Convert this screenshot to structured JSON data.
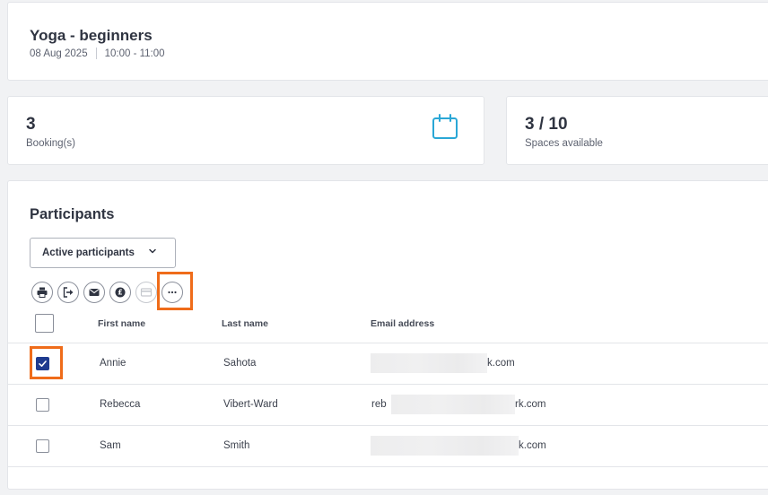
{
  "session": {
    "title": "Yoga - beginners",
    "date": "08 Aug 2025",
    "time": "10:00 - 11:00"
  },
  "stats": {
    "bookings": {
      "value": "3",
      "label": "Booking(s)",
      "icon": "calendar-icon"
    },
    "spaces": {
      "value": "3 / 10",
      "label": "Spaces available"
    }
  },
  "participants": {
    "title": "Participants",
    "filter": {
      "selected": "Active participants"
    },
    "toolbar": [
      {
        "name": "print",
        "icon": "printer-icon",
        "enabled": true
      },
      {
        "name": "export",
        "icon": "export-icon",
        "enabled": true
      },
      {
        "name": "email",
        "icon": "envelope-icon",
        "enabled": true
      },
      {
        "name": "payment",
        "icon": "pound-coin-icon",
        "enabled": true
      },
      {
        "name": "card",
        "icon": "credit-card-icon",
        "enabled": false
      },
      {
        "name": "more",
        "icon": "ellipsis-icon",
        "enabled": true
      }
    ],
    "columns": {
      "first_name": "First name",
      "last_name": "Last name",
      "email": "Email address"
    },
    "rows": [
      {
        "checked": true,
        "first_name": "Annie",
        "last_name": "Sahota",
        "email_start": "",
        "email_end": "k.com"
      },
      {
        "checked": false,
        "first_name": "Rebecca",
        "last_name": "Vibert-Ward",
        "email_start": "reb",
        "email_end": "rk.com"
      },
      {
        "checked": false,
        "first_name": "Sam",
        "last_name": "Smith",
        "email_start": "",
        "email_end": "k.com"
      }
    ]
  },
  "colors": {
    "accent": "#1f3b8f",
    "highlight": "#ef6c1a",
    "calendar": "#2aa7d6"
  }
}
